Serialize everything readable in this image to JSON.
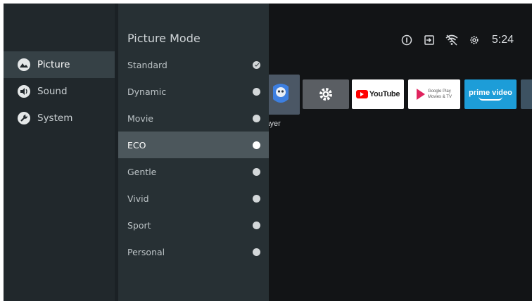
{
  "status_bar": {
    "icons": [
      "info-icon",
      "input-source-icon",
      "wifi-icon",
      "settings-gear-icon"
    ],
    "time": "5:24"
  },
  "home": {
    "apps": [
      {
        "name": "player-app",
        "label": "layer"
      },
      {
        "name": "settings-app"
      },
      {
        "name": "youtube-app",
        "text": "YouTube"
      },
      {
        "name": "google-play-movies-app",
        "text_line1": "Google Play",
        "text_line2": "Movies & TV"
      },
      {
        "name": "prime-video-app",
        "text": "prime video"
      },
      {
        "name": "more-app"
      }
    ]
  },
  "settings": {
    "categories": [
      {
        "label": "Picture",
        "icon": "picture-icon",
        "selected": true
      },
      {
        "label": "Sound",
        "icon": "sound-icon",
        "selected": false
      },
      {
        "label": "System",
        "icon": "wrench-icon",
        "selected": false
      }
    ],
    "picture_mode": {
      "title": "Picture Mode",
      "options": [
        {
          "label": "Standard",
          "checked": true,
          "focused": false
        },
        {
          "label": "Dynamic",
          "checked": false,
          "focused": false
        },
        {
          "label": "Movie",
          "checked": false,
          "focused": false
        },
        {
          "label": "ECO",
          "checked": false,
          "focused": true
        },
        {
          "label": "Gentle",
          "checked": false,
          "focused": false
        },
        {
          "label": "Vivid",
          "checked": false,
          "focused": false
        },
        {
          "label": "Sport",
          "checked": false,
          "focused": false
        },
        {
          "label": "Personal",
          "checked": false,
          "focused": false
        }
      ]
    }
  },
  "colors": {
    "background": "#121416",
    "category_panel": "#21282c",
    "options_panel": "#273034",
    "focused_row": "#4c575c",
    "selected_category": "#364146",
    "prime_blue": "#1d9dd8",
    "youtube_red": "#ff0000"
  }
}
